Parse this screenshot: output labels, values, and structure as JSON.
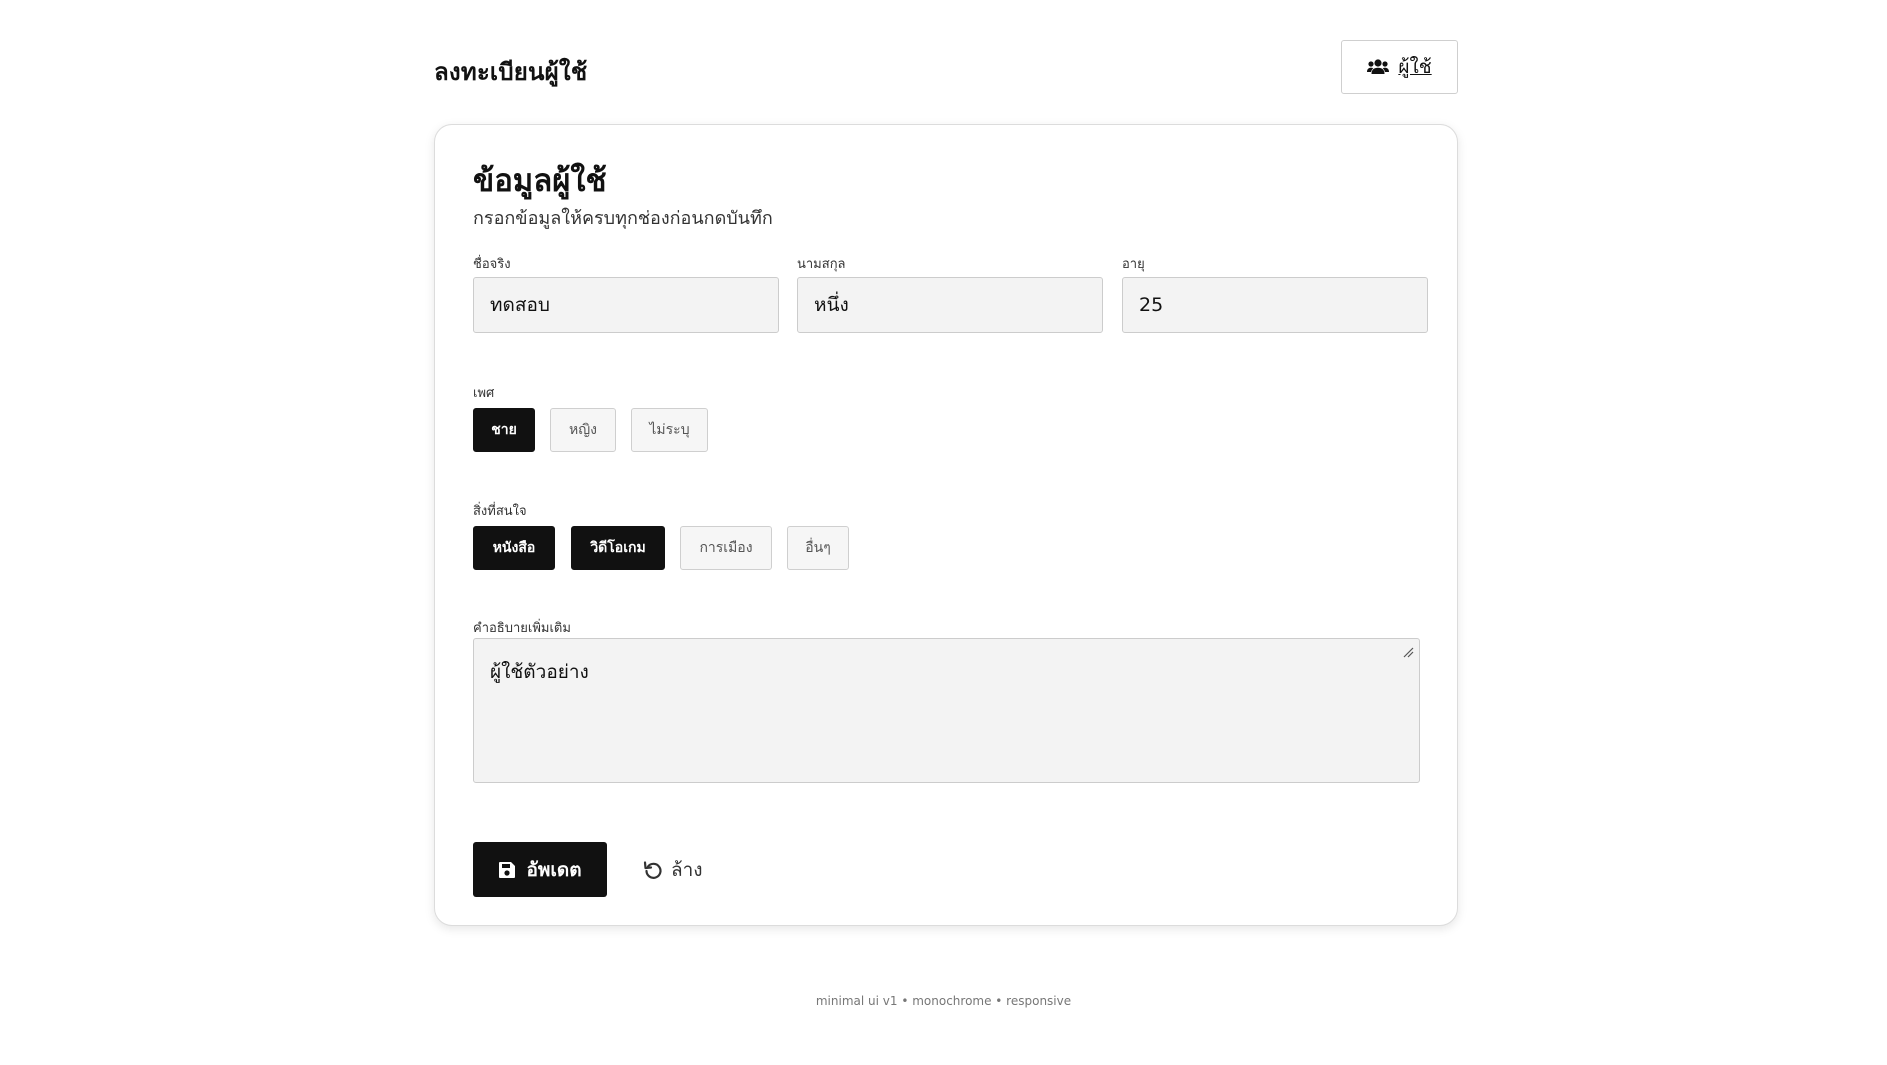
{
  "header": {
    "title": "ลงทะเบียนผู้ใช้",
    "users_button_label": "ผู้ใช้",
    "users_button_icon": "users-icon"
  },
  "card": {
    "title": "ข้อมูลผู้ใช้",
    "subtitle": "กรอกข้อมูลให้ครบทุกช่องก่อนกดบันทึก",
    "fields": {
      "first_name": {
        "label": "ชื่อจริง",
        "value": "ทดสอบ"
      },
      "last_name": {
        "label": "นามสกุล",
        "value": "หนึ่ง"
      },
      "age": {
        "label": "อายุ",
        "value": "25"
      }
    },
    "gender": {
      "label": "เพศ",
      "options": [
        {
          "label": "ชาย",
          "selected": true
        },
        {
          "label": "หญิง",
          "selected": false
        },
        {
          "label": "ไม่ระบุ",
          "selected": false
        }
      ]
    },
    "interests": {
      "label": "สิ่งที่สนใจ",
      "options": [
        {
          "label": "หนังสือ",
          "selected": true
        },
        {
          "label": "วิดีโอเกม",
          "selected": true
        },
        {
          "label": "การเมือง",
          "selected": false
        },
        {
          "label": "อื่นๆ",
          "selected": false
        }
      ]
    },
    "description": {
      "label": "คำอธิบายเพิ่มเติม",
      "value": "ผู้ใช้ตัวอย่าง"
    },
    "actions": {
      "submit_label": "อัพเดต",
      "submit_icon": "floppy-disk-icon",
      "reset_label": "ล้าง",
      "reset_icon": "undo-icon"
    }
  },
  "footer": {
    "text": "minimal ui v1 • monochrome • responsive"
  },
  "colors": {
    "primary": "#111111",
    "input_bg": "#f3f3f3",
    "border": "#cccccc"
  }
}
